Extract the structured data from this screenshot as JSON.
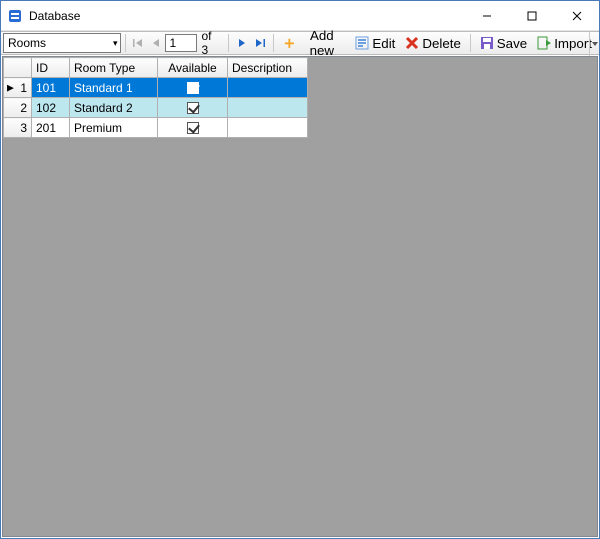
{
  "window": {
    "title": "Database"
  },
  "toolbar": {
    "combo_value": "Rooms",
    "position_value": "1",
    "of_label": "of 3",
    "add_label": "Add new",
    "edit_label": "Edit",
    "delete_label": "Delete",
    "save_label": "Save",
    "import_label": "Import"
  },
  "grid": {
    "columns": {
      "id": "ID",
      "room_type": "Room Type",
      "available": "Available",
      "description": "Description"
    },
    "rows": [
      {
        "n": "1",
        "id": "101",
        "room_type": "Standard 1",
        "available": true,
        "description": "",
        "selected": true
      },
      {
        "n": "2",
        "id": "102",
        "room_type": "Standard 2",
        "available": true,
        "description": "",
        "alt": true
      },
      {
        "n": "3",
        "id": "201",
        "room_type": "Premium",
        "available": true,
        "description": ""
      }
    ]
  }
}
